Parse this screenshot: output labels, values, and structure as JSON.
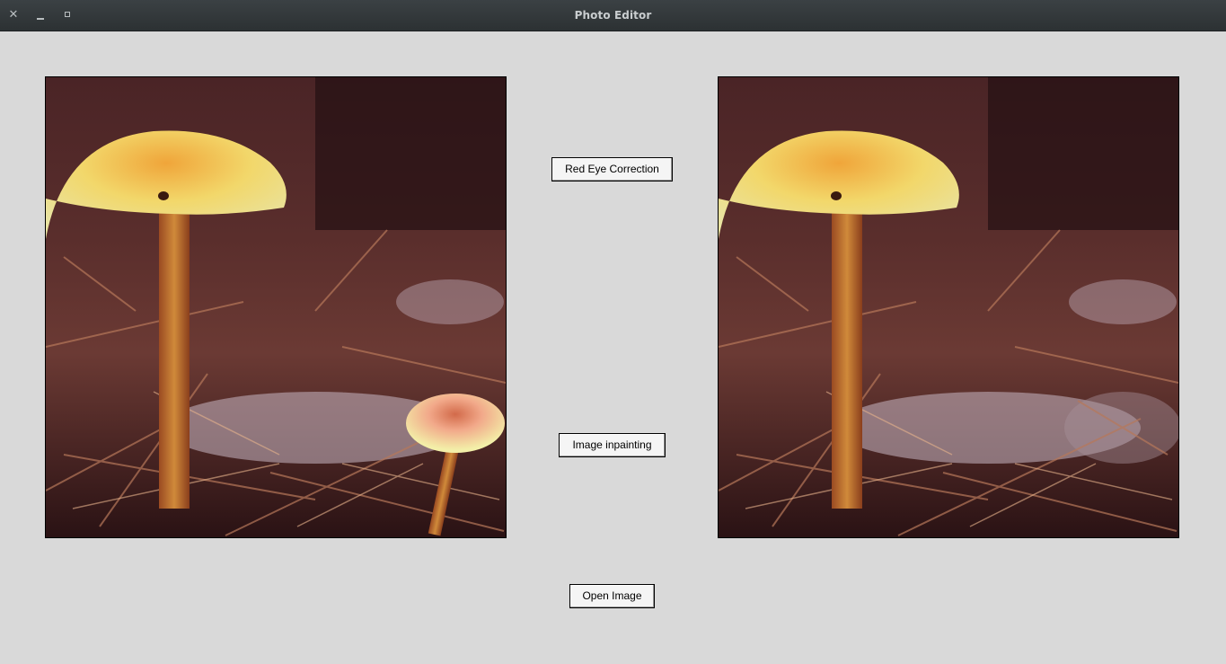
{
  "window": {
    "title": "Photo Editor",
    "controls": {
      "close_glyph": "✕",
      "minimize_icon": "minimize-icon",
      "maximize_icon": "maximize-icon"
    }
  },
  "images": {
    "original": {
      "content": "mushroom-photo",
      "small_mushroom": true
    },
    "result": {
      "content": "mushroom-photo-inpainted",
      "small_mushroom": false
    }
  },
  "buttons": {
    "red_eye": "Red Eye Correction",
    "inpainting": "Image inpainting",
    "open_image": "Open Image"
  },
  "colors": {
    "background": "#d9d9d9",
    "titlebar": "#33383a",
    "title_text": "#c9cdcf",
    "button_face": "#f5f5f5"
  }
}
